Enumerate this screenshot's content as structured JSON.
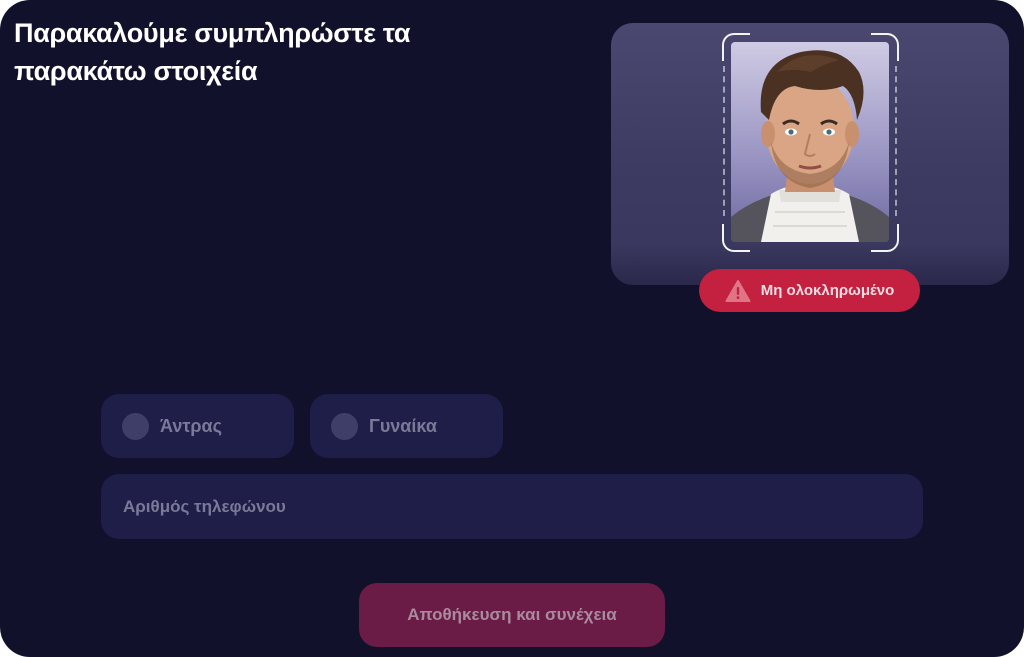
{
  "form": {
    "title": "Παρακαλούμε συμπληρώστε τα παρακάτω στοιχεία",
    "photo": {
      "status_label": "Μη ολοκληρωμένο",
      "status_icon": "warning-icon",
      "status_color": "#c4203f"
    },
    "gender": {
      "options": [
        {
          "label": "Άντρας",
          "selected": false
        },
        {
          "label": "Γυναίκα",
          "selected": false
        }
      ]
    },
    "phone": {
      "placeholder": "Αριθμός τηλεφώνου",
      "value": ""
    },
    "submit_label": "Αποθήκευση και συνέχεια"
  },
  "colors": {
    "background": "#12112c",
    "field_background": "#1f1e48",
    "accent_button": "#6a1b46"
  }
}
